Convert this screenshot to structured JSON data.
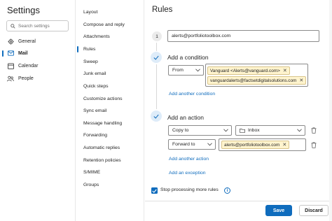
{
  "settings": {
    "title": "Settings",
    "search_placeholder": "Search settings",
    "nav": [
      {
        "label": "General",
        "icon": "gear-icon"
      },
      {
        "label": "Mail",
        "icon": "mail-icon"
      },
      {
        "label": "Calendar",
        "icon": "calendar-icon"
      },
      {
        "label": "People",
        "icon": "people-icon"
      }
    ]
  },
  "mail_menu": {
    "items": [
      "Layout",
      "Compose and reply",
      "Attachments",
      "Rules",
      "Sweep",
      "Junk email",
      "Quick steps",
      "Customize actions",
      "Sync email",
      "Message handling",
      "Forwarding",
      "Automatic replies",
      "Retention policies",
      "S/MIME",
      "Groups"
    ],
    "active_index": 3
  },
  "rules": {
    "title": "Rules",
    "step_number": "1",
    "rule_name": "alerts@portfoliotoolbox.com",
    "condition": {
      "title": "Add a condition",
      "type": "From",
      "values": [
        "Vanguard <Alerts@vanguard.com>",
        "vanguardalerts@factsetdigitalsolutions.com"
      ],
      "add_link": "Add another condition"
    },
    "action": {
      "title": "Add an action",
      "action1_type": "Copy to",
      "action1_folder": "Inbox",
      "action2_type": "Forward to",
      "action2_recipients": [
        "alerts@portfoliotoolbox.com"
      ],
      "add_link": "Add another action",
      "exception_link": "Add an exception"
    },
    "stop_processing": {
      "label": "Stop processing more rules",
      "checked": true
    },
    "save_label": "Save",
    "discard_label": "Discard"
  },
  "colors": {
    "accent": "#0f6cbd",
    "tag_bg": "#fff4ce",
    "step_bg": "#deecf9"
  }
}
